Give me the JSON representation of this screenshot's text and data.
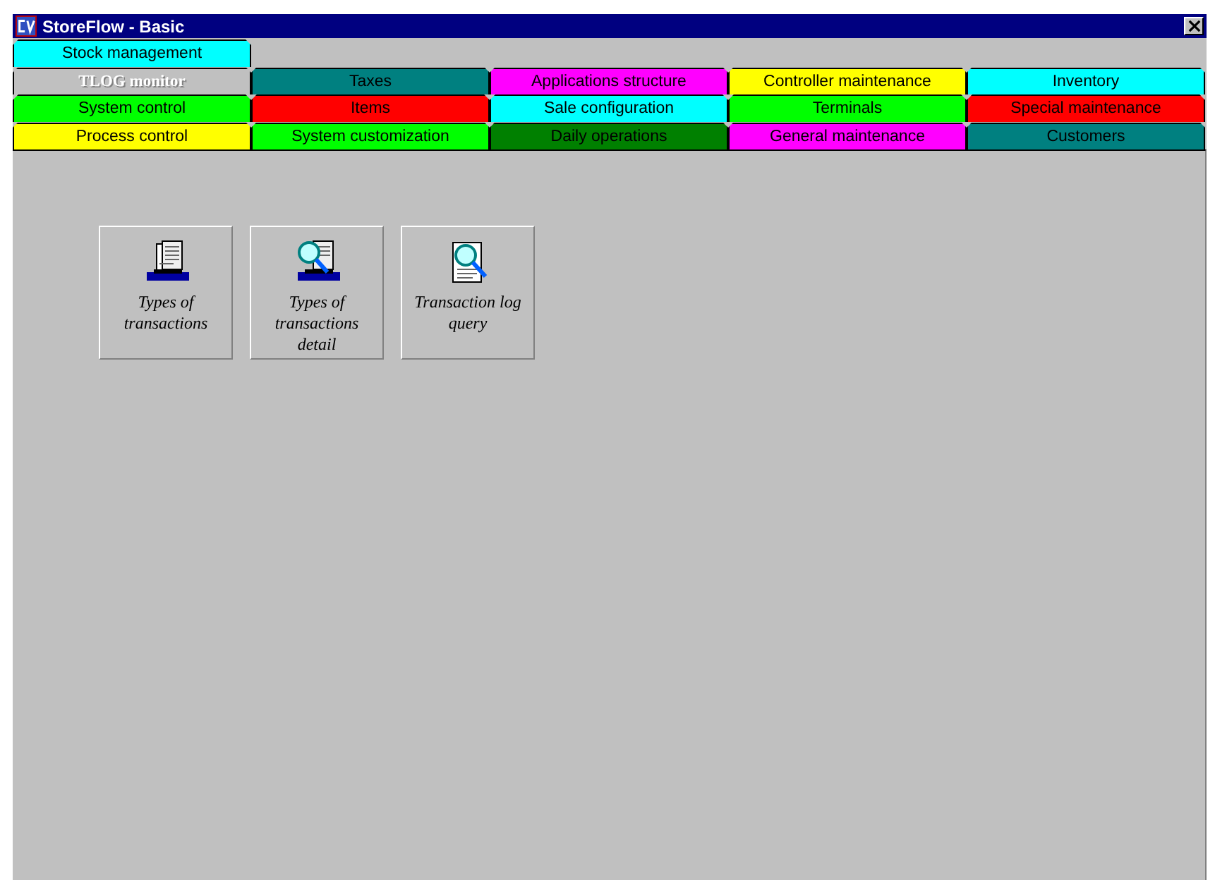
{
  "window": {
    "title": "StoreFlow - Basic"
  },
  "tab_rows": [
    {
      "tabs": [
        {
          "label": "Stock management",
          "color": "#00ffff",
          "selected": false
        }
      ]
    },
    {
      "tabs": [
        {
          "label": "TLOG monitor",
          "color": "#c0c0c0",
          "selected": true
        },
        {
          "label": "Taxes",
          "color": "#008080",
          "selected": false
        },
        {
          "label": "Applications structure",
          "color": "#ff00ff",
          "selected": false
        },
        {
          "label": "Controller maintenance",
          "color": "#ffff00",
          "selected": false
        },
        {
          "label": "Inventory",
          "color": "#00ffff",
          "selected": false
        }
      ]
    },
    {
      "tabs": [
        {
          "label": "System control",
          "color": "#00ff00",
          "selected": false
        },
        {
          "label": "Items",
          "color": "#ff0000",
          "selected": false
        },
        {
          "label": "Sale configuration",
          "color": "#00ffff",
          "selected": false
        },
        {
          "label": "Terminals",
          "color": "#00ff00",
          "selected": false
        },
        {
          "label": "Special maintenance",
          "color": "#ff0000",
          "selected": false
        }
      ]
    },
    {
      "tabs": [
        {
          "label": "Process control",
          "color": "#ffff00",
          "selected": false
        },
        {
          "label": "System customization",
          "color": "#00ff00",
          "selected": false
        },
        {
          "label": "Daily operations",
          "color": "#008000",
          "selected": false
        },
        {
          "label": "General maintenance",
          "color": "#ff00ff",
          "selected": false
        },
        {
          "label": "Customers",
          "color": "#008080",
          "selected": false
        }
      ]
    }
  ],
  "tiles": [
    {
      "label": "Types of transactions",
      "kind": "printer"
    },
    {
      "label": "Types of transactions detail",
      "kind": "printer-search"
    },
    {
      "label": "Transaction log query",
      "kind": "document-search"
    }
  ]
}
